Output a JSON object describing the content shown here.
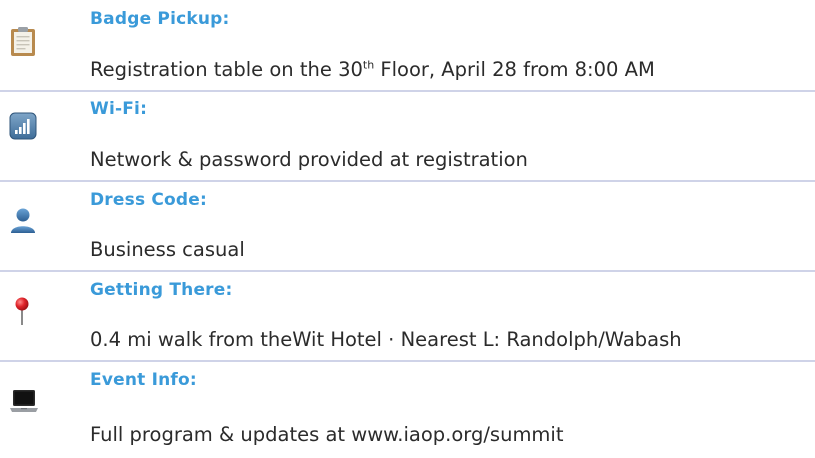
{
  "items": [
    {
      "title": "Badge Pickup:",
      "text_pre": "Registration table on the 30",
      "text_sup": "th",
      "text_post": " Floor, April 28 from 8:00 AM",
      "icon": "clipboard-icon"
    },
    {
      "title": "Wi-Fi:",
      "text": "Network & password provided at registration",
      "icon": "signal-bars-icon"
    },
    {
      "title": "Dress Code:",
      "text": "Business casual",
      "icon": "person-icon"
    },
    {
      "title": "Getting There:",
      "text": "0.4 mi walk from theWit Hotel · Nearest L: Randolph/Wabash",
      "icon": "map-pin-icon"
    },
    {
      "title": "Event Info:",
      "text": "Full program & updates at  www.iaop.org/summit",
      "icon": "laptop-icon"
    }
  ],
  "colors": {
    "title": "#3a9ad9",
    "text": "#2b2b2b",
    "divider": "#cfd3e8"
  }
}
